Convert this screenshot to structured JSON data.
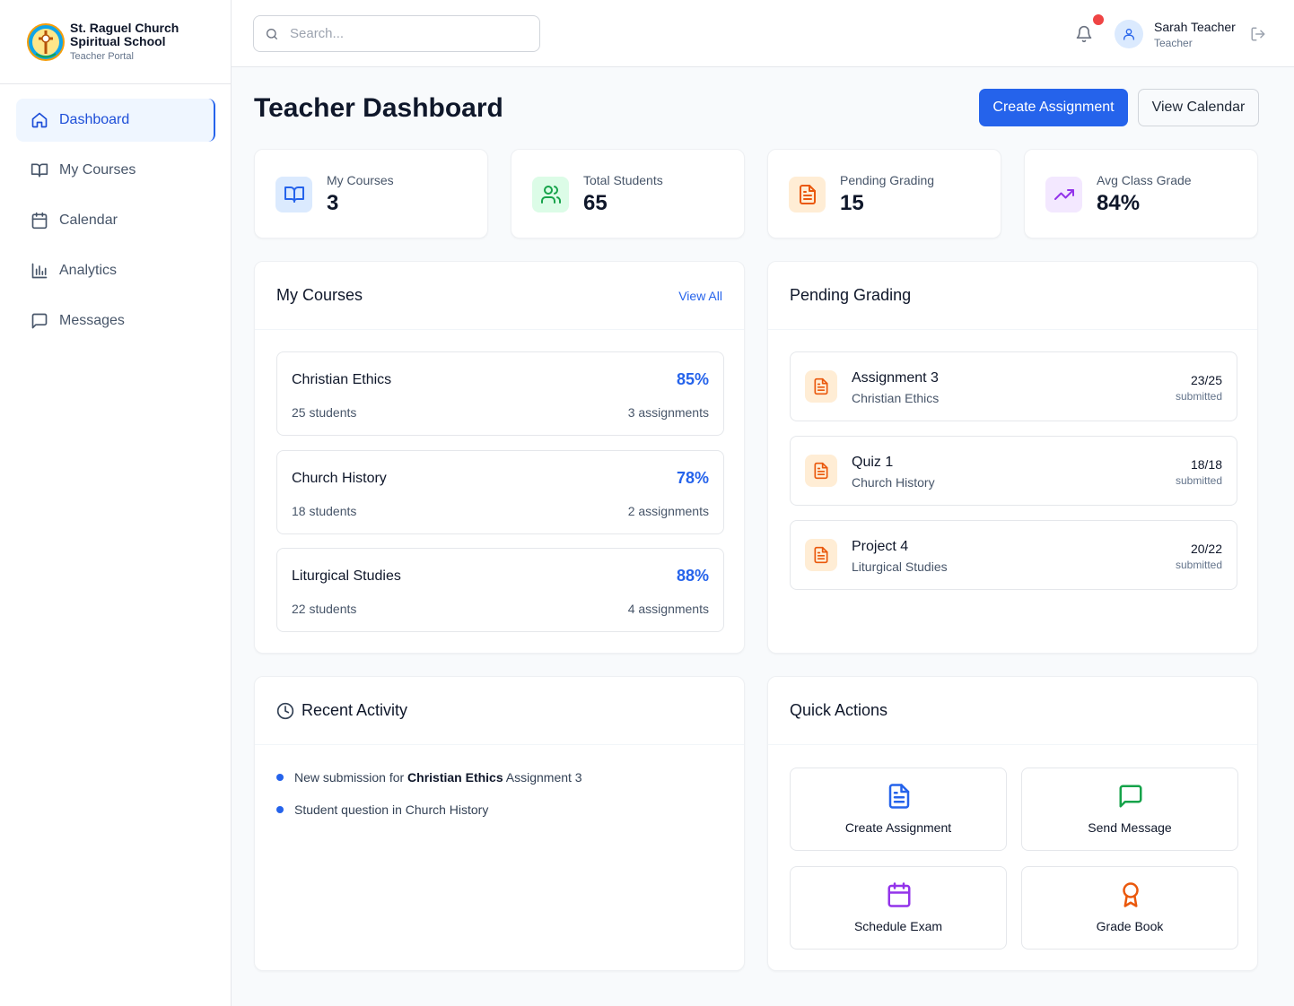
{
  "brand": {
    "line1": "St. Raguel Church",
    "line2": "Spiritual School",
    "line3": "Teacher Portal"
  },
  "sidebar": {
    "items": [
      {
        "label": "Dashboard",
        "icon": "home-icon",
        "active": true
      },
      {
        "label": "My Courses",
        "icon": "book-open-icon"
      },
      {
        "label": "Calendar",
        "icon": "calendar-icon"
      },
      {
        "label": "Analytics",
        "icon": "bar-chart-icon"
      },
      {
        "label": "Messages",
        "icon": "message-icon"
      }
    ]
  },
  "header": {
    "search_placeholder": "Search...",
    "user_name": "Sarah Teacher",
    "user_role": "Teacher"
  },
  "page": {
    "title": "Teacher Dashboard",
    "primary_button": "Create Assignment",
    "secondary_button": "View Calendar"
  },
  "stats": [
    {
      "label": "My Courses",
      "value": "3",
      "icon": "book-open-icon",
      "color": "#2563eb",
      "bg": "#dbeafe"
    },
    {
      "label": "Total Students",
      "value": "65",
      "icon": "users-icon",
      "color": "#16a34a",
      "bg": "#dcfce7"
    },
    {
      "label": "Pending Grading",
      "value": "15",
      "icon": "file-text-icon",
      "color": "#ea580c",
      "bg": "#ffedd5"
    },
    {
      "label": "Avg Class Grade",
      "value": "84%",
      "icon": "trending-up-icon",
      "color": "#9333ea",
      "bg": "#f3e8ff"
    }
  ],
  "courses": {
    "title": "My Courses",
    "view_all": "View All",
    "items": [
      {
        "name": "Christian Ethics",
        "percent": "85%",
        "students": "25 students",
        "assignments": "3 assignments"
      },
      {
        "name": "Church History",
        "percent": "78%",
        "students": "18 students",
        "assignments": "2 assignments"
      },
      {
        "name": "Liturgical Studies",
        "percent": "88%",
        "students": "22 students",
        "assignments": "4 assignments"
      }
    ]
  },
  "pending": {
    "title": "Pending Grading",
    "items": [
      {
        "title": "Assignment 3",
        "course": "Christian Ethics",
        "count": "23/25",
        "status": "submitted"
      },
      {
        "title": "Quiz 1",
        "course": "Church History",
        "count": "18/18",
        "status": "submitted"
      },
      {
        "title": "Project 4",
        "course": "Liturgical Studies",
        "count": "20/22",
        "status": "submitted"
      }
    ]
  },
  "activity": {
    "title": "Recent Activity",
    "items": [
      {
        "prefix": "New submission for ",
        "bold": "Christian Ethics",
        "suffix": " Assignment 3"
      },
      {
        "prefix": "Student question in Church History",
        "bold": "",
        "suffix": ""
      }
    ]
  },
  "quick_actions": {
    "title": "Quick Actions",
    "items": [
      {
        "label": "Create Assignment",
        "icon": "file-text-icon",
        "color": "#2563eb"
      },
      {
        "label": "Send Message",
        "icon": "message-icon",
        "color": "#16a34a"
      },
      {
        "label": "Schedule Exam",
        "icon": "calendar-icon",
        "color": "#9333ea"
      },
      {
        "label": "Grade Book",
        "icon": "award-icon",
        "color": "#ea580c"
      }
    ]
  },
  "colors": {
    "accent": "#2563eb",
    "notification": "#ef4444"
  }
}
